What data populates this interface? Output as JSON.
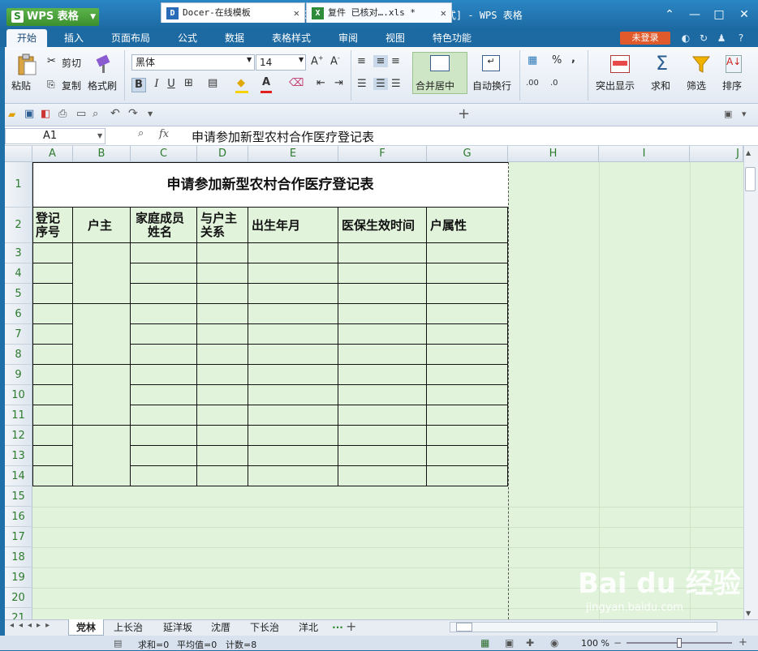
{
  "app": {
    "button_label": "WPS 表格",
    "logo_letter": "S",
    "window_title": "复件 已核对长治片人员2015.xls * [兼容模式] - WPS 表格"
  },
  "menu": {
    "tabs": [
      "开始",
      "插入",
      "页面布局",
      "公式",
      "数据",
      "表格样式",
      "审阅",
      "视图",
      "特色功能"
    ],
    "login_label": "未登录"
  },
  "ribbon": {
    "paste": "粘贴",
    "cut": "剪切",
    "copy": "复制",
    "format_painter": "格式刷",
    "font_name": "黑体",
    "font_size": "14",
    "merge_center": "合并居中",
    "wrap_text": "自动换行",
    "highlight": "突出显示",
    "sum": "求和",
    "filter": "筛选",
    "sort": "排序",
    "bold": "B",
    "italic": "I",
    "underline": "U",
    "percent": "%",
    "comma": ",",
    "dec_inc": ".00",
    "dec_dec": ".0"
  },
  "doc_tabs": [
    {
      "label": "Docer-在线模板",
      "icon": "D"
    },
    {
      "label": "复件 已核对….xls *",
      "icon": "X"
    }
  ],
  "formula_bar": {
    "cell_ref": "A1",
    "fx": "fx",
    "content": "申请参加新型农村合作医疗登记表"
  },
  "columns": [
    "A",
    "B",
    "C",
    "D",
    "E",
    "F",
    "G",
    "H",
    "I",
    "J"
  ],
  "rows": [
    "1",
    "2",
    "3",
    "4",
    "5",
    "6",
    "7",
    "8",
    "9",
    "10",
    "11",
    "12",
    "13",
    "14",
    "15",
    "16",
    "17",
    "18",
    "19",
    "20",
    "21"
  ],
  "sheet": {
    "title": "申请参加新型农村合作医疗登记表",
    "headers": {
      "a": [
        "登记",
        "序号"
      ],
      "b": "户主",
      "c": [
        "家庭成员",
        "姓名"
      ],
      "d": [
        "与户主",
        "关系"
      ],
      "e": "出生年月",
      "f": "医保生效时间",
      "g": "户属性"
    }
  },
  "sheet_tabs": [
    "党林",
    "上长治",
    "延洋坂",
    "沈厝",
    "下长治",
    "洋北"
  ],
  "sheet_tab_more": "···",
  "status": {
    "sum": "求和=0",
    "average": "平均值=0",
    "count": "计数=8",
    "zoom": "100 %"
  },
  "watermark": {
    "text": "Bai du 经验",
    "url": "jingyan.baidu.com"
  },
  "colors": {
    "title_bar": "#1d6aa3",
    "grid_bg": "#e2f3dc",
    "login": "#e05a2b",
    "app_button": "#4aa23c"
  }
}
